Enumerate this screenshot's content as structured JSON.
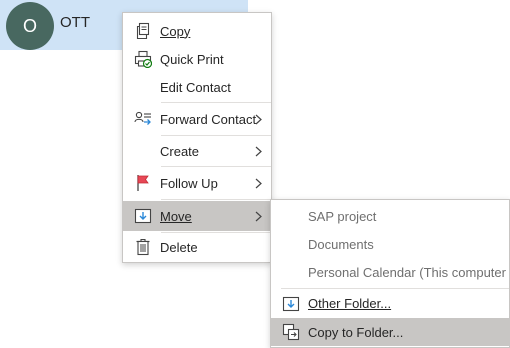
{
  "contact": {
    "avatar_initial": "O",
    "name": "OTT"
  },
  "context_menu": {
    "items": [
      {
        "label": "Copy",
        "icon": "copy-icon"
      },
      {
        "label": "Quick Print",
        "icon": "quick-print-icon"
      },
      {
        "label": "Edit Contact",
        "icon": ""
      },
      {
        "label": "Forward Contact",
        "icon": "forward-contact-icon",
        "has_submenu": true
      },
      {
        "label": "Create",
        "icon": "",
        "has_submenu": true
      },
      {
        "label": "Follow Up",
        "icon": "red-flag-icon",
        "has_submenu": true
      },
      {
        "label": "Move",
        "icon": "move-to-folder-icon",
        "has_submenu": true,
        "highlighted": true
      },
      {
        "label": "Delete",
        "icon": "trash-icon"
      }
    ]
  },
  "move_submenu": {
    "recent_folders": [
      "SAP project",
      "Documents",
      "Personal Calendar (This computer ..."
    ],
    "items": [
      {
        "label": "Other Folder...",
        "icon": "move-to-folder-icon"
      },
      {
        "label": "Copy to Folder...",
        "icon": "copy-to-folder-icon",
        "highlighted": true
      }
    ]
  },
  "colors": {
    "selection_band": "#cfe3f6",
    "avatar_bg": "#486860",
    "highlight": "#c8c6c4",
    "flag": "#e74856",
    "accent_blue": "#2b88d8"
  }
}
